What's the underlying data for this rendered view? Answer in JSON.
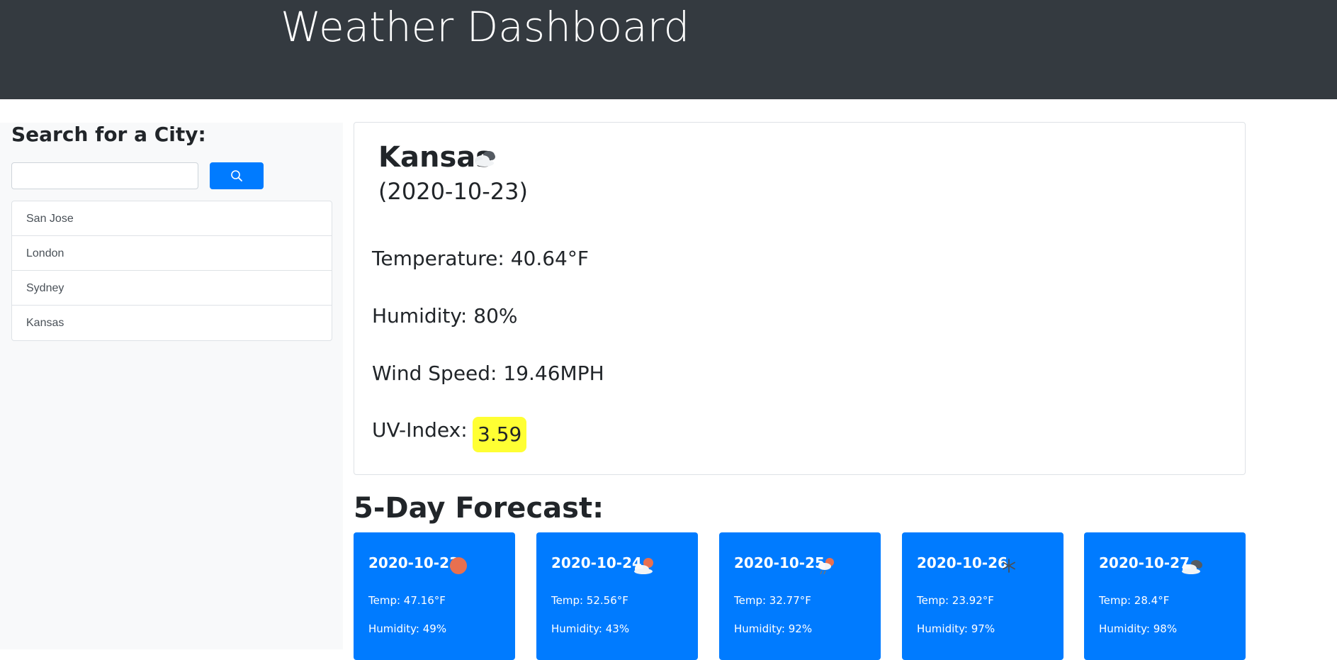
{
  "header": {
    "title": "Weather Dashboard"
  },
  "sidebar": {
    "heading": "Search for a City:",
    "search_value": "",
    "search_icon": "search-icon",
    "cities": [
      "San Jose",
      "London",
      "Sydney",
      "Kansas"
    ]
  },
  "current": {
    "city": "Kansas",
    "icon": "broken-clouds-icon",
    "date": "(2020-10-23)",
    "temperature": "Temperature: 40.64°F",
    "humidity": "Humidity: 80%",
    "wind": "Wind Speed: 19.46MPH",
    "uv_label": "UV-Index:",
    "uv_value": "3.59",
    "uv_color": "#ffff33"
  },
  "forecast": {
    "heading": "5-Day Forecast:",
    "card_color": "#007bff",
    "days": [
      {
        "date": "2020-10-23",
        "icon": "clear-sun-icon",
        "temp": "Temp: 47.16°F",
        "humidity": "Humidity: 49%"
      },
      {
        "date": "2020-10-24",
        "icon": "few-clouds-icon",
        "temp": "Temp: 52.56°F",
        "humidity": "Humidity: 43%"
      },
      {
        "date": "2020-10-25",
        "icon": "rain-icon",
        "temp": "Temp: 32.77°F",
        "humidity": "Humidity: 92%"
      },
      {
        "date": "2020-10-26",
        "icon": "snow-icon",
        "temp": "Temp: 23.92°F",
        "humidity": "Humidity: 97%"
      },
      {
        "date": "2020-10-27",
        "icon": "broken-clouds-icon",
        "temp": "Temp: 28.4°F",
        "humidity": "Humidity: 98%"
      }
    ]
  }
}
